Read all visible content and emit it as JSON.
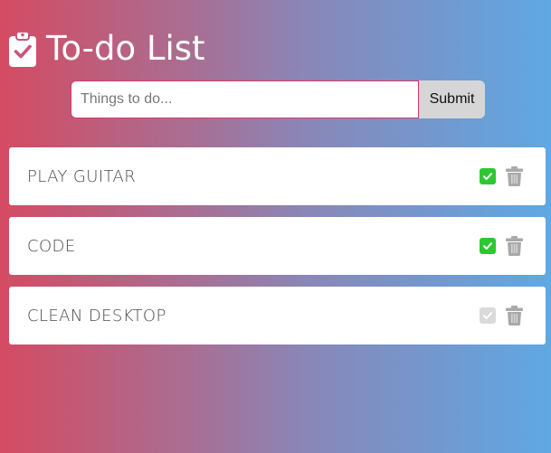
{
  "header": {
    "icon": "clipboard-check-icon",
    "title": "To-do List"
  },
  "form": {
    "input_value": "",
    "input_placeholder": "Things to do...",
    "submit_label": "Submit"
  },
  "colors": {
    "gradient_left": "#d44b63",
    "gradient_right": "#5fa8e3",
    "check_done": "#2ec731",
    "check_undone": "#dadada",
    "trash": "#a9a9a9",
    "input_border": "#d8386a"
  },
  "todos": [
    {
      "label": "PLAY GUITAR",
      "done": true,
      "check_icon": "check-icon",
      "delete_icon": "trash-icon"
    },
    {
      "label": "CODE",
      "done": true,
      "check_icon": "check-icon",
      "delete_icon": "trash-icon"
    },
    {
      "label": "CLEAN DESKTOP",
      "done": false,
      "check_icon": "check-icon",
      "delete_icon": "trash-icon"
    }
  ]
}
